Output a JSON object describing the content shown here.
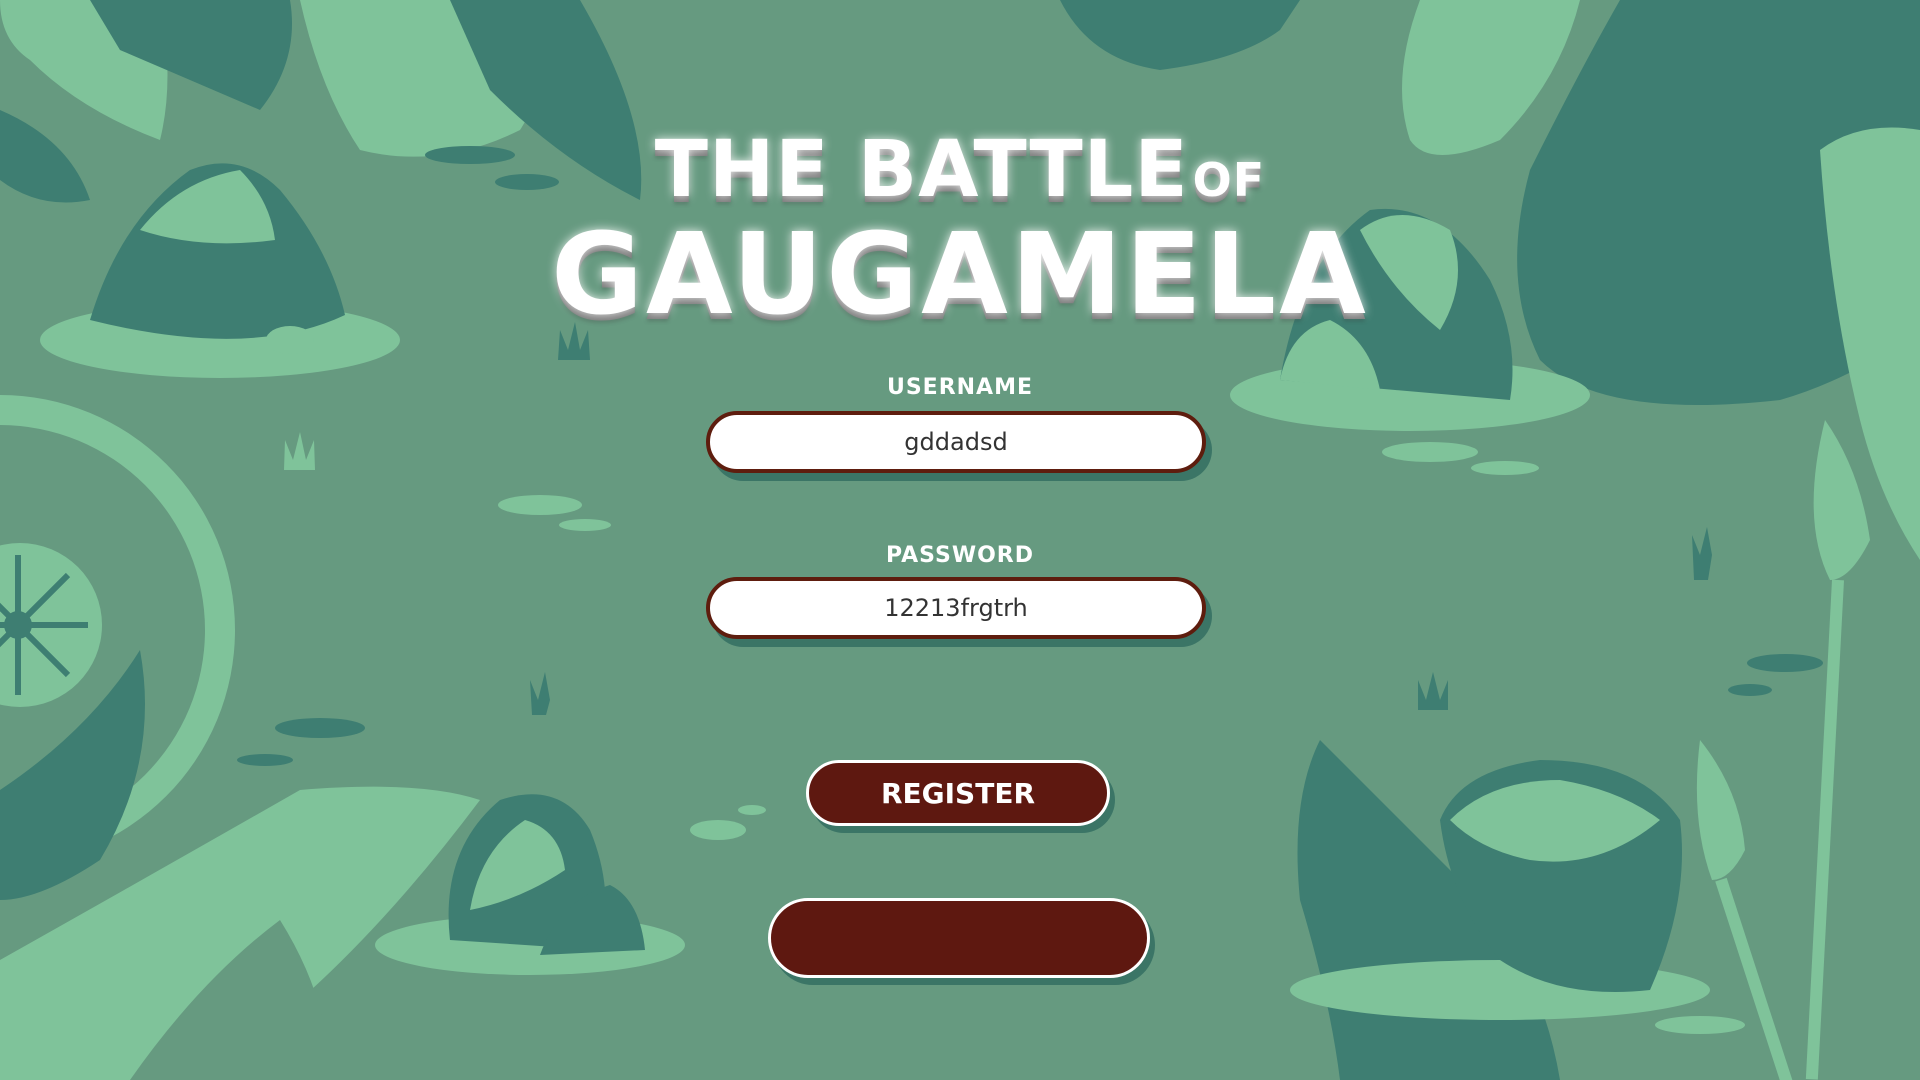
{
  "title": {
    "line1": "THE BATTLE",
    "of": "OF",
    "line2": "GAUGAMELA"
  },
  "form": {
    "username_label": "USERNAME",
    "username_value": "gddadsd",
    "password_label": "PASSWORD",
    "password_value": "12213frgtrh"
  },
  "buttons": {
    "register_label": "REGISTER",
    "secondary_label": ""
  },
  "colors": {
    "background": "#669a80",
    "dark_green": "#3e7e72",
    "light_green": "#7fc39a",
    "button_brown": "#5e1810",
    "input_border": "#5e1d0e"
  }
}
